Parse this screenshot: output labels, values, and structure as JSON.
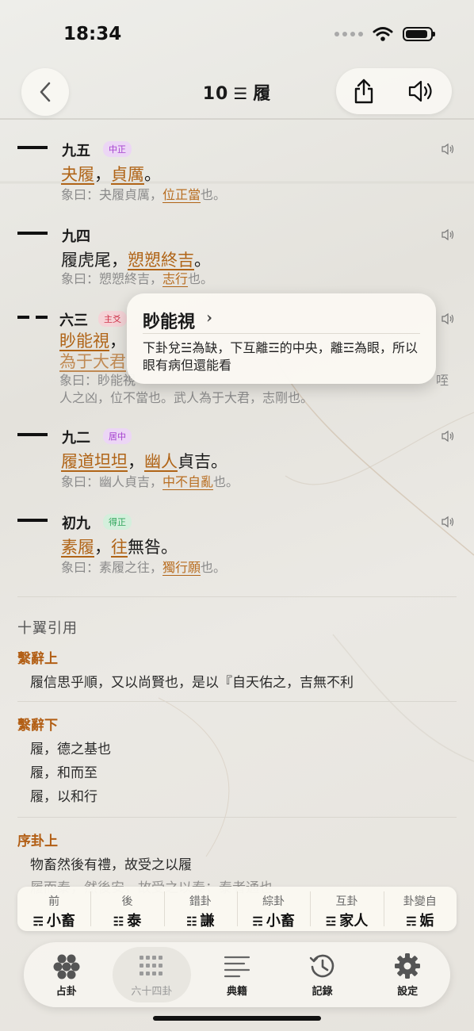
{
  "status": {
    "time": "18:34"
  },
  "nav": {
    "number": "10",
    "trigram": "☰",
    "name": "履"
  },
  "lines": [
    {
      "position": "九五",
      "type": "yang",
      "tag": "中正",
      "tag_color": "purple",
      "text": [
        {
          "t": "夬履",
          "hl": true
        },
        {
          "t": "，"
        },
        {
          "t": "貞厲",
          "hl": true
        },
        {
          "t": "。"
        }
      ],
      "xiang": [
        {
          "t": "象曰：夬履貞厲，"
        },
        {
          "t": "位正當",
          "hl": true
        },
        {
          "t": "也。"
        }
      ]
    },
    {
      "position": "九四",
      "type": "yang",
      "tag": "",
      "tag_color": "",
      "text": [
        {
          "t": "履虎尾，"
        },
        {
          "t": "愬愬終吉",
          "hl": true
        },
        {
          "t": "。"
        }
      ],
      "xiang": [
        {
          "t": "象曰：愬愬終吉，"
        },
        {
          "t": "志行",
          "hl": true
        },
        {
          "t": "也。"
        }
      ]
    },
    {
      "position": "六三",
      "type": "yin",
      "tag": "主爻",
      "tag_color": "red",
      "text": [
        {
          "t": "眇能視",
          "hl": true
        },
        {
          "t": "，"
        }
      ],
      "text2": [
        {
          "t": "為于大君",
          "hl": true
        }
      ],
      "xiang": [
        {
          "t": "象曰：眇能視"
        }
      ],
      "xiang_tail": "咥",
      "xiang2": "人之凶，位不當也。武人為于大君，志剛也。"
    },
    {
      "position": "九二",
      "type": "yang",
      "tag": "居中",
      "tag_color": "purple",
      "text": [
        {
          "t": "履道坦坦",
          "hl": true
        },
        {
          "t": "，"
        },
        {
          "t": "幽人",
          "hl": true
        },
        {
          "t": "貞吉。"
        }
      ],
      "xiang": [
        {
          "t": "象曰：幽人貞吉，"
        },
        {
          "t": "中不自亂",
          "hl": true
        },
        {
          "t": "也。"
        }
      ]
    },
    {
      "position": "初九",
      "type": "yang",
      "tag": "得正",
      "tag_color": "green",
      "text": [
        {
          "t": "素履",
          "hl": true
        },
        {
          "t": "，"
        },
        {
          "t": "往",
          "hl": true
        },
        {
          "t": "無咎。"
        }
      ],
      "xiang": [
        {
          "t": "象曰：素履之往，"
        },
        {
          "t": "獨行願",
          "hl": true
        },
        {
          "t": "也。"
        }
      ]
    }
  ],
  "popover": {
    "title": "眇能視",
    "body": "下卦兌☱為缺，下互離☲的中央，離☲為眼，所以眼有病但還能看"
  },
  "commentary": {
    "heading": "十翼引用",
    "sections": [
      {
        "title": "繫辭上",
        "quotes": [
          "履信思乎順，又以尚賢也，是以『自天佑之，吉無不利"
        ]
      },
      {
        "title": "繫辭下",
        "quotes": [
          "履，德之基也",
          "履，和而至",
          "履，以和行"
        ]
      },
      {
        "title": "序卦上",
        "quotes": [
          "物畜然後有禮，故受之以履",
          "履而泰，然後安，故受之以泰；泰者通也"
        ]
      }
    ]
  },
  "relations": [
    {
      "label": "前",
      "glyph": "☴",
      "name": "小畜"
    },
    {
      "label": "後",
      "glyph": "☷",
      "name": "泰"
    },
    {
      "label": "錯卦",
      "glyph": "☷",
      "name": "謙"
    },
    {
      "label": "綜卦",
      "glyph": "☴",
      "name": "小畜"
    },
    {
      "label": "互卦",
      "glyph": "☲",
      "name": "家人"
    },
    {
      "label": "卦變自",
      "glyph": "☴",
      "name": "姤"
    }
  ],
  "tabs": [
    {
      "label": "占卦",
      "icon": "coins-icon",
      "active": false
    },
    {
      "label": "六十四卦",
      "icon": "grid-icon",
      "active": true
    },
    {
      "label": "典籍",
      "icon": "text-lines-icon",
      "active": false
    },
    {
      "label": "記錄",
      "icon": "history-icon",
      "active": false
    },
    {
      "label": "設定",
      "icon": "gear-icon",
      "active": false
    }
  ]
}
